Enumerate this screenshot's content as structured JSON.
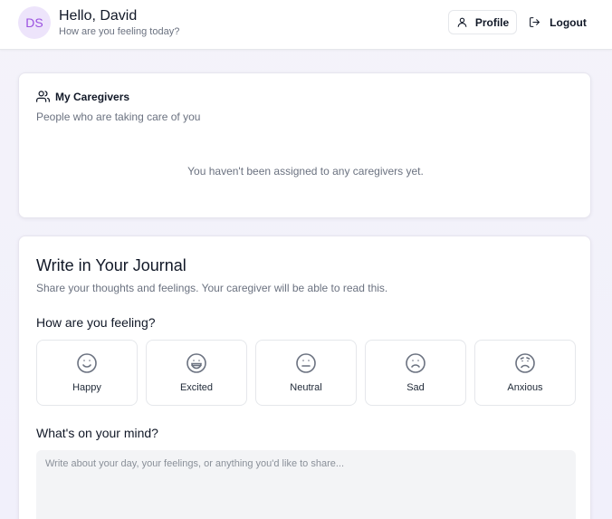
{
  "header": {
    "avatar_initials": "DS",
    "greeting": "Hello, David",
    "subtitle": "How are you feeling today?",
    "profile_label": "Profile",
    "logout_label": "Logout"
  },
  "caregivers": {
    "title": "My Caregivers",
    "description": "People who are taking care of you",
    "empty_message": "You haven't been assigned to any caregivers yet."
  },
  "journal": {
    "title": "Write in Your Journal",
    "description": "Share your thoughts and feelings. Your caregiver will be able to read this.",
    "feeling_label": "How are you feeling?",
    "moods": [
      {
        "label": "Happy",
        "icon": "smile-icon"
      },
      {
        "label": "Excited",
        "icon": "grin-icon"
      },
      {
        "label": "Neutral",
        "icon": "neutral-face-icon"
      },
      {
        "label": "Sad",
        "icon": "frown-icon"
      },
      {
        "label": "Anxious",
        "icon": "worried-face-icon"
      }
    ],
    "mind_label": "What's on your mind?",
    "entry_placeholder": "Write about your day, your feelings, or anything you'd like to share..."
  },
  "colors": {
    "accent": "#9b51e0",
    "avatar_bg": "#ede4fb",
    "muted_text": "#6b7280"
  }
}
